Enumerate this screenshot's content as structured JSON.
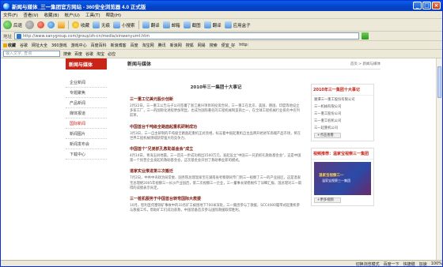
{
  "window": {
    "title": "新闻与媒体_三一集团官方网站 - 360安全浏览器 4.0 正式版",
    "min": "_",
    "max": "□",
    "close": "×"
  },
  "menu": [
    "文件(F)",
    "查看(V)",
    "收藏(B)",
    "帐户(U)",
    "工具(T)",
    "帮助(H)"
  ],
  "toolbar": {
    "back": "后退",
    "forward": "",
    "stop": "",
    "refresh": "",
    "home": "",
    "fav": "收藏",
    "mute": "无痕",
    "qh": "小搜索",
    "items": [
      "翻译",
      "邮箱",
      "截图",
      "翻译",
      "应用盒子"
    ]
  },
  "address": {
    "label": "地址",
    "url": "http://www.sanygroup.com/group/zh-cn/media/xinwenyumt.htm",
    "go": ""
  },
  "favorites": [
    "收藏",
    "谷歌",
    "网址大全",
    "360游戏",
    "游戏中心",
    "百度百科",
    "新浪博客",
    "百度",
    "淘宝网",
    "腾讯",
    "新浪网",
    "搜狐",
    "网易",
    "搜索",
    "便宜_好",
    "http:"
  ],
  "searchbar": {
    "placeholder": "输入文字, 查询",
    "items": [
      "搜索",
      "百度",
      "谷歌",
      "淘宝",
      "必应"
    ]
  },
  "page": {
    "left_title": "新闻与媒体",
    "left_nav": [
      "企业新闻",
      "专题聚焦",
      "产品新闻",
      "媒体报道",
      "国际新闻",
      "新闻图片",
      "新闻发布会",
      "下载中心"
    ],
    "main_title": "新闻与媒体",
    "crumb": "首页 > 新闻与媒体",
    "article_title": "2010年三一集团十大事记",
    "items": [
      {
        "h": "三一重工亿美元股价创新",
        "p": "2月22日，三一重工公告与子公司签署了浙江嘉兴项目的投资合同，三一重工在北京、美国、德国、印度等地设立多家工厂，三一的国际化进程更加明显，也成为国际著名的工程机械制造商之一，在全球工程机械行业排名中名列前茅。"
      },
      {
        "h": "中国首台千吨级全路面起重机研制成功",
        "p": "3月3日，三一自主研制的千吨级全路面起重机正式亮相，标志着中国起重机自主品牌开始进军高端产品市场，将在世界工程机械领域获得强大的竞争力。"
      },
      {
        "h": "中国首个\"兄弟抓孔救助基金会\"成立",
        "p": "4月14日，青海玉树地震。三一首先一步成功捐出1500万元，发起设立\"中国三一兄弟抓孔救助基金会\"，这是中国第一个民营企业发起的救助基金会，这次基金会开创了救助事业新的模式。"
      },
      {
        "h": "道家实业推进第三次搬迁",
        "p": "7月2日，中共中央政治局常委、国务院总理温家宝在湖南省考察期间专门到三一视察了三一的产业园区，这是温家宝总理继2005年视察三一长沙产业园后，第二次视察三一企业，三一董事长梁稳根作了详细汇报，温总理对三一取得的成绩表示肯定。"
      },
      {
        "h": "三一桩机服务于中国首台转弯国际大救援",
        "p": "10月，智利圣何塞铜矿事故中的33名矿工被困地下700米深处，三一集团参与了救援，SCC4000履带式起重机参与救援工作，帮助矿工们成功获救，中国装备首次参与国际救援取得胜利。"
      }
    ],
    "side1": {
      "title": "2010年三一集团十大事记",
      "links": [
        "湘潭三一重工股份有限公司",
        "三一机械有限公司",
        "三一重工股份公司",
        "三一重工桩机公司",
        "三一起重机公司"
      ],
      "more": "+点击查看"
    },
    "side2": {
      "title": "视频推荐：温家宝视察三一集团",
      "video_caption": "温家宝视察三一",
      "video_sub": "温家宝视察三一集团",
      "more": "+更多视频"
    }
  },
  "status": {
    "left": "",
    "items": [
      "切换浏览模式",
      "百度一下",
      "快捷键",
      "加速",
      "100%"
    ]
  }
}
